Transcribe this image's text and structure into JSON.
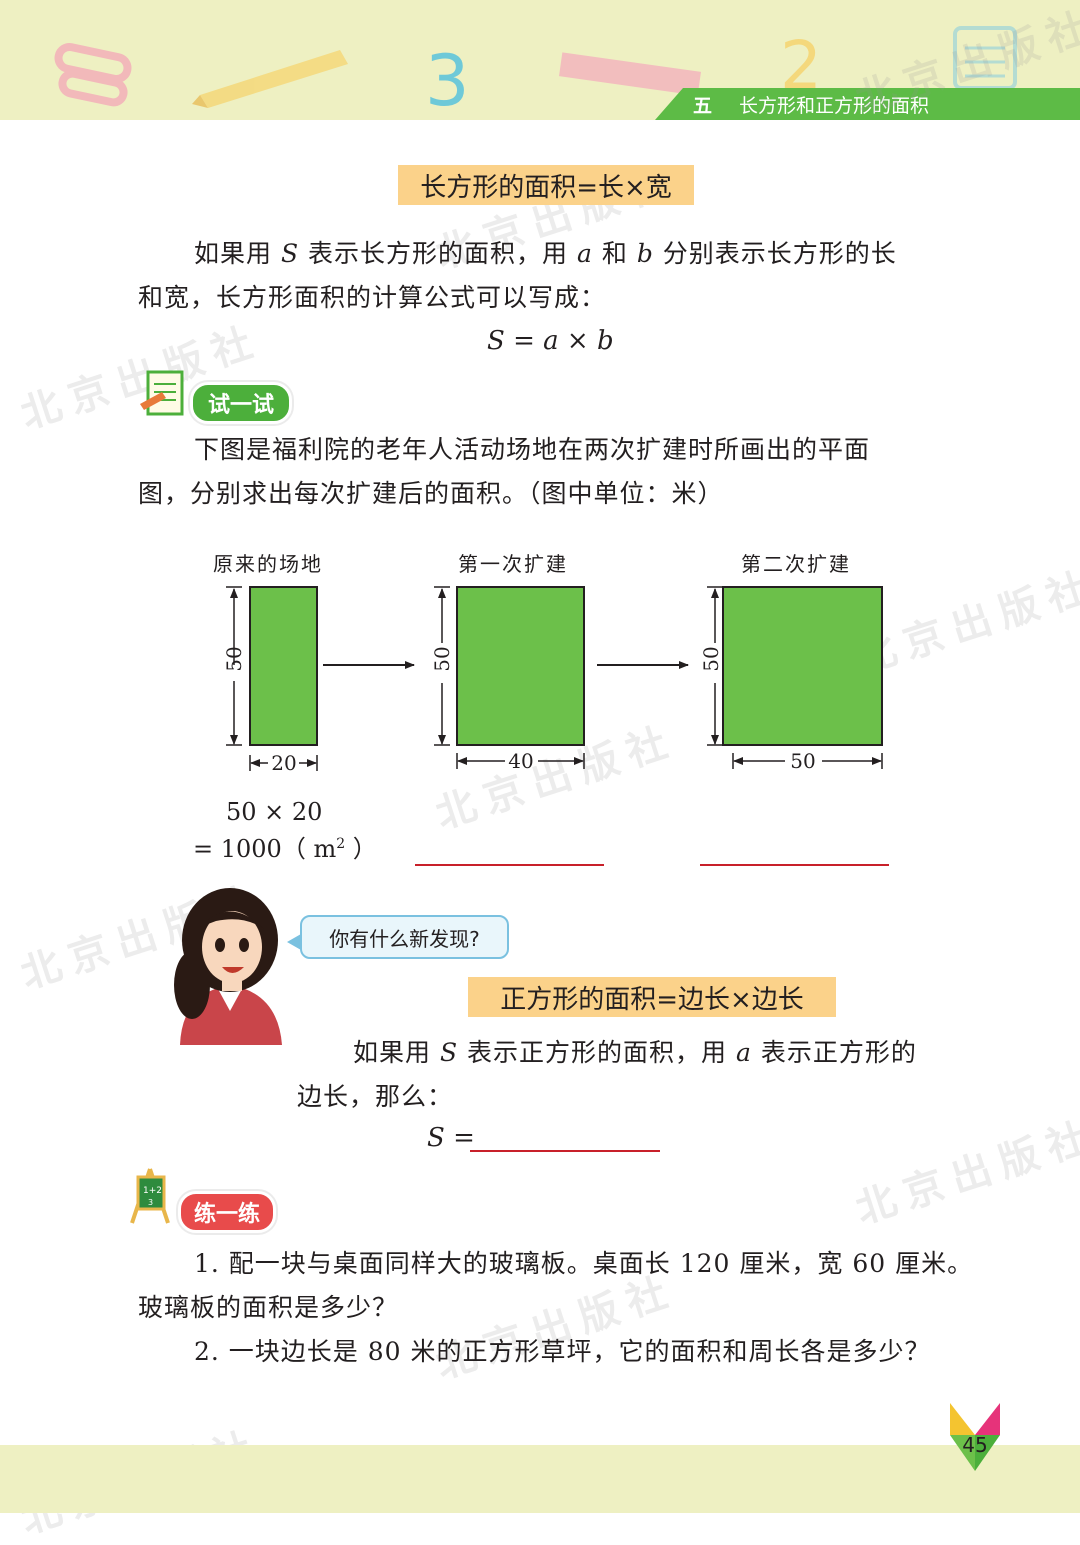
{
  "header": {
    "chapter_number": "五",
    "chapter_title": "长方形和正方形的面积"
  },
  "watermark_text": "北京出版社",
  "rect_formula": "长方形的面积=长×宽",
  "rect_explain": {
    "line1_a": "如果用 ",
    "var_s": "S",
    "line1_b": " 表示长方形的面积，用 ",
    "var_a": "a",
    "line1_c": " 和 ",
    "var_b": "b",
    "line1_d": " 分别表示长方形的长",
    "line2": "和宽，长方形面积的计算公式可以写成：",
    "formula": "S = a × b"
  },
  "try_section": {
    "badge": "试一试",
    "text_line1": "下图是福利院的老年人活动场地在两次扩建时所画出的平面",
    "text_line2": "图，分别求出每次扩建后的面积。（图中单位：米）"
  },
  "diagram": {
    "fields": [
      {
        "label": "原来的场地",
        "height": "50",
        "width": "20"
      },
      {
        "label": "第一次扩建",
        "height": "50",
        "width": "40"
      },
      {
        "label": "第二次扩建",
        "height": "50",
        "width": "50"
      }
    ],
    "fill_color": "#6cc04a"
  },
  "worked_answer": {
    "line1": "50 × 20",
    "line2_prefix": "=  1000（ m",
    "line2_sup": "2",
    "line2_suffix": " ）"
  },
  "teacher_bubble": "你有什么新发现?",
  "square_formula": "正方形的面积=边长×边长",
  "square_explain": {
    "line1_a": "如果用 ",
    "var_s": "S",
    "line1_b": " 表示正方形的面积，用 ",
    "var_a": "a",
    "line1_c": " 表示正方形的",
    "line2": "边长，那么：",
    "blank_prefix": "S ="
  },
  "practice_section": {
    "badge": "练一练",
    "q1_line1": "1.  配一块与桌面同样大的玻璃板。桌面长 120 厘米，宽 60 厘米。",
    "q1_line2": "玻璃板的面积是多少？",
    "q2": "2.  一块边长是 80 米的正方形草坪，它的面积和周长各是多少？"
  },
  "page_number": "45"
}
